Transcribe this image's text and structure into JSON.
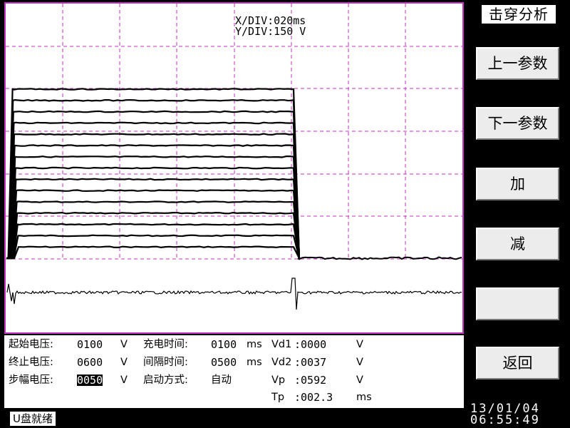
{
  "scope": {
    "x_div": "X/DIV:020ms",
    "y_div": "Y/DIV:150 V",
    "grid_color": "#c230c2",
    "trace_color": "#000000",
    "step_count": 15,
    "plateau_end_fraction": 0.63
  },
  "params": {
    "rows": [
      [
        {
          "label": "起始电压:",
          "value": "0100",
          "unit": "V"
        },
        {
          "label": "充电时间:",
          "value": "0100",
          "unit": "ms"
        },
        {
          "label": "Vd1",
          "value": ":0000",
          "unit": "V"
        }
      ],
      [
        {
          "label": "终止电压:",
          "value": "0600",
          "unit": "V"
        },
        {
          "label": "间隔时间:",
          "value": "0500",
          "unit": "ms"
        },
        {
          "label": "Vd2",
          "value": ":0037",
          "unit": "V"
        }
      ],
      [
        {
          "label": "步幅电压:",
          "value": "0050",
          "unit": "V"
        },
        {
          "label": "启动方式:",
          "value": "自动",
          "unit": ""
        },
        {
          "label": "Vp",
          "value": ":0592",
          "unit": "V"
        }
      ],
      [
        {
          "label": "",
          "value": "",
          "unit": ""
        },
        {
          "label": "",
          "value": "",
          "unit": ""
        },
        {
          "label": "Tp",
          "value": ":002.3",
          "unit": "ms"
        }
      ]
    ]
  },
  "sidebar": {
    "title": "击穿分析",
    "buttons": [
      "上一参数",
      "下一参数",
      "加",
      "减",
      "",
      "返回"
    ]
  },
  "status": {
    "usb": "U盘就绪",
    "date": "13/01/04",
    "time": "06:55:49"
  }
}
